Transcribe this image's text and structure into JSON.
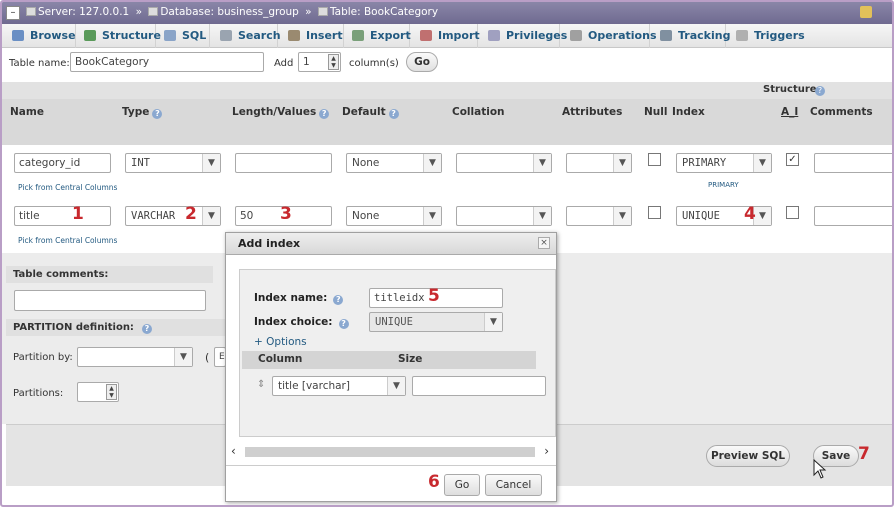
{
  "breadcrumb": {
    "server": "Server: 127.0.0.1",
    "database": "Database: business_group",
    "table": "Table: BookCategory",
    "separator": "»"
  },
  "tabs": [
    {
      "label": "Browse",
      "icon": "browse-icon",
      "color": "#6a8fc4"
    },
    {
      "label": "Structure",
      "icon": "structure-icon",
      "color": "#5a9a5a"
    },
    {
      "label": "SQL",
      "icon": "sql-icon",
      "color": "#8aa4c8"
    },
    {
      "label": "Search",
      "icon": "search-icon",
      "color": "#9aa4b0"
    },
    {
      "label": "Insert",
      "icon": "insert-icon",
      "color": "#9a8a70"
    },
    {
      "label": "Export",
      "icon": "export-icon",
      "color": "#7aa07a"
    },
    {
      "label": "Import",
      "icon": "import-icon",
      "color": "#c07070"
    },
    {
      "label": "Privileges",
      "icon": "privileges-icon",
      "color": "#a0a0c0"
    },
    {
      "label": "Operations",
      "icon": "operations-icon",
      "color": "#a0a0a0"
    },
    {
      "label": "Tracking",
      "icon": "tracking-icon",
      "color": "#8090a0"
    },
    {
      "label": "Triggers",
      "icon": "triggers-icon",
      "color": "#b0b0b0"
    }
  ],
  "table_name_row": {
    "label": "Table name:",
    "value": "BookCategory",
    "add_label": "Add",
    "add_count": "1",
    "columns_label": "column(s)",
    "go_label": "Go"
  },
  "structure": {
    "title": "Structure",
    "headers": {
      "name": "Name",
      "type": "Type",
      "length": "Length/Values",
      "default": "Default",
      "collation": "Collation",
      "attributes": "Attributes",
      "null": "Null",
      "index": "Index",
      "ai": "A_I",
      "comments": "Comments"
    },
    "rows": [
      {
        "name": "category_id",
        "type": "INT",
        "length": "",
        "default": "None",
        "collation": "",
        "attributes": "",
        "null_checked": false,
        "index": "PRIMARY",
        "index_note": "PRIMARY",
        "ai_checked": true,
        "central": "Pick from Central Columns"
      },
      {
        "name": "title",
        "type": "VARCHAR",
        "length": "50",
        "default": "None",
        "collation": "",
        "attributes": "",
        "null_checked": false,
        "index": "UNIQUE",
        "index_note": "",
        "ai_checked": false,
        "central": "Pick from Central Columns"
      }
    ]
  },
  "table_comments_label": "Table comments:",
  "partition": {
    "title": "PARTITION definition:",
    "by_label": "Partition by:",
    "partitions_label": "Partitions:",
    "paren": "(",
    "expr_hint": "E"
  },
  "bottom": {
    "preview_sql": "Preview SQL",
    "save": "Save"
  },
  "modal": {
    "title": "Add index",
    "close": "×",
    "index_name_label": "Index name:",
    "index_name_value": "titleidx",
    "index_choice_label": "Index choice:",
    "index_choice_value": "UNIQUE",
    "options_link": "+ Options",
    "col_header": "Column",
    "size_header": "Size",
    "column_value": "title [varchar]",
    "size_value": "",
    "go": "Go",
    "cancel": "Cancel"
  },
  "annotations": [
    "1",
    "2",
    "3",
    "4",
    "5",
    "6",
    "7"
  ],
  "colors": {
    "annotation": "#c8292e",
    "link": "#235a81",
    "frame": "#b99ec6"
  }
}
